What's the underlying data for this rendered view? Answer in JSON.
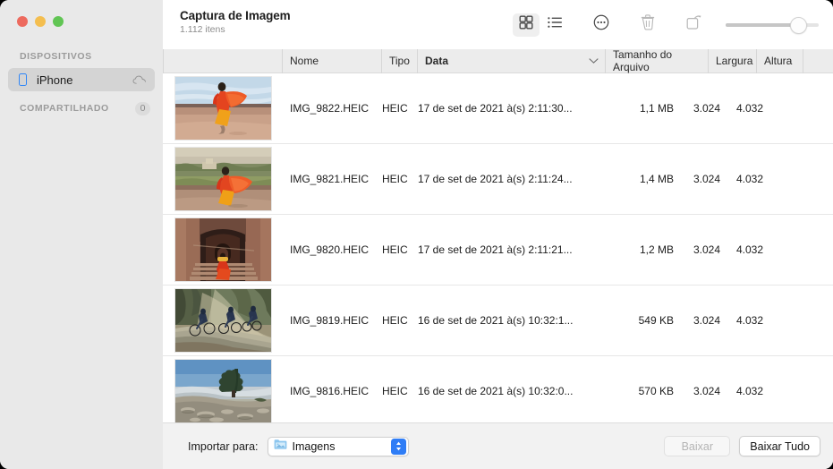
{
  "window": {
    "traffic_lights": [
      {
        "name": "close",
        "color": "#ED6A5E"
      },
      {
        "name": "minimize",
        "color": "#F4BE4F"
      },
      {
        "name": "zoom",
        "color": "#61C554"
      }
    ]
  },
  "sidebar": {
    "sections": [
      {
        "header": "DISPOSITIVOS",
        "badge": null,
        "items": [
          {
            "label": "iPhone",
            "icon": "iphone-icon",
            "trailing_icon": "cloud-icon",
            "selected": true
          }
        ]
      },
      {
        "header": "COMPARTILHADO",
        "badge": "0",
        "items": []
      }
    ]
  },
  "toolbar": {
    "title": "Captura de Imagem",
    "subtitle": "1.112 itens",
    "buttons": [
      {
        "name": "grid-view-button",
        "icon": "grid-icon",
        "selected": true
      },
      {
        "name": "list-view-button",
        "icon": "list-icon",
        "selected": false
      },
      {
        "name": "more-button",
        "icon": "ellipsis-circle-icon",
        "selected": false
      },
      {
        "name": "delete-button",
        "icon": "trash-icon",
        "selected": false
      },
      {
        "name": "rotate-button",
        "icon": "rotate-icon",
        "selected": false
      }
    ],
    "zoom_slider": {
      "name": "thumbnail-size-slider",
      "value_percent": 76
    }
  },
  "table": {
    "columns": [
      {
        "key": "name",
        "label": "Nome",
        "sorted": false
      },
      {
        "key": "type",
        "label": "Tipo",
        "sorted": false
      },
      {
        "key": "date",
        "label": "Data",
        "sorted": true,
        "sort_icon": "chevron-down-icon"
      },
      {
        "key": "size",
        "label": "Tamanho do Arquivo",
        "sorted": false
      },
      {
        "key": "width",
        "label": "Largura",
        "sorted": false
      },
      {
        "key": "height",
        "label": "Altura",
        "sorted": false
      }
    ],
    "rows": [
      {
        "thumb": "woman-red-sari-monument",
        "name": "IMG_9822.HEIC",
        "type": "HEIC",
        "date": "17 de set de 2021 à(s) 2:11:30...",
        "size": "1,1 MB",
        "width": "3.024",
        "height": "4.032"
      },
      {
        "thumb": "woman-red-sari-garden",
        "name": "IMG_9821.HEIC",
        "type": "HEIC",
        "date": "17 de set de 2021 à(s) 2:11:24...",
        "size": "1,4 MB",
        "width": "3.024",
        "height": "4.032"
      },
      {
        "thumb": "woman-red-dress-archway-stairs",
        "name": "IMG_9820.HEIC",
        "type": "HEIC",
        "date": "17 de set de 2021 à(s) 2:11:21...",
        "size": "1,2 MB",
        "width": "3.024",
        "height": "4.032"
      },
      {
        "thumb": "cyclists-misty-road",
        "name": "IMG_9819.HEIC",
        "type": "HEIC",
        "date": "16 de set de 2021 à(s) 10:32:1...",
        "size": "549 KB",
        "width": "3.024",
        "height": "4.032"
      },
      {
        "thumb": "mountain-pine-above-clouds",
        "name": "IMG_9816.HEIC",
        "type": "HEIC",
        "date": "16 de set de 2021 à(s) 10:32:0...",
        "size": "570 KB",
        "width": "3.024",
        "height": "4.032"
      }
    ]
  },
  "bottom_bar": {
    "import_label": "Importar para:",
    "destination": {
      "value": "Imagens",
      "icon": "pictures-folder-icon"
    },
    "download_button": {
      "label": "Baixar",
      "disabled": true
    },
    "download_all_button": {
      "label": "Baixar Tudo",
      "disabled": false
    }
  },
  "colors": {
    "accent": "#2F7DF6",
    "sidebar_bg": "#E9E9E9",
    "header_bg": "#ECECEC",
    "bottom_bar_bg": "#F2F2F2"
  }
}
